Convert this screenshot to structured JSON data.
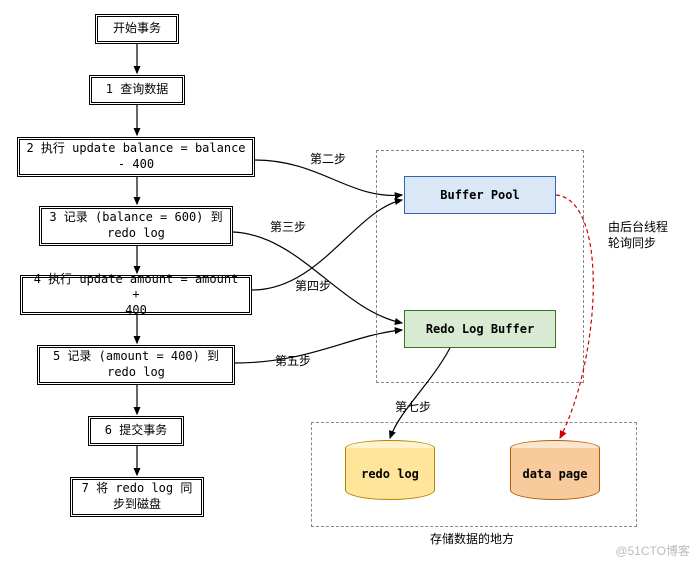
{
  "chart_data": {
    "type": "flowchart",
    "title": "",
    "nodes": [
      {
        "id": "start",
        "label": "开始事务",
        "type": "process"
      },
      {
        "id": "n1",
        "label": "1 查询数据",
        "type": "process"
      },
      {
        "id": "n2",
        "label": "2 执行 update balance = balance - 400",
        "type": "process"
      },
      {
        "id": "n3",
        "label": "3 记录 (balance = 600) 到 redo log",
        "type": "process"
      },
      {
        "id": "n4",
        "label": "4 执行 update amount = amount + 400",
        "type": "process"
      },
      {
        "id": "n5",
        "label": "5 记录 (amount = 400)  到 redo log",
        "type": "process"
      },
      {
        "id": "n6",
        "label": "6 提交事务",
        "type": "process"
      },
      {
        "id": "n7",
        "label": "7 将 redo log 同步到磁盘",
        "type": "process"
      },
      {
        "id": "bp",
        "label": "Buffer Pool",
        "type": "buffer"
      },
      {
        "id": "rlb",
        "label": "Redo Log Buffer",
        "type": "buffer"
      },
      {
        "id": "rlog",
        "label": "redo log",
        "type": "storage"
      },
      {
        "id": "dpage",
        "label": "data page",
        "type": "storage"
      }
    ],
    "edges": [
      {
        "from": "start",
        "to": "n1"
      },
      {
        "from": "n1",
        "to": "n2"
      },
      {
        "from": "n2",
        "to": "n3"
      },
      {
        "from": "n3",
        "to": "n4"
      },
      {
        "from": "n4",
        "to": "n5"
      },
      {
        "from": "n5",
        "to": "n6"
      },
      {
        "from": "n6",
        "to": "n7"
      },
      {
        "from": "n2",
        "to": "bp",
        "label": "第二步"
      },
      {
        "from": "n3",
        "to": "rlb",
        "label": "第三步"
      },
      {
        "from": "n4",
        "to": "bp",
        "label": "第四步"
      },
      {
        "from": "n5",
        "to": "rlb",
        "label": "第五步"
      },
      {
        "from": "rlb",
        "to": "rlog",
        "label": "第七步"
      },
      {
        "from": "bp",
        "to": "dpage",
        "label": "由后台线程轮询同步",
        "style": "dashed"
      }
    ],
    "groups": [
      {
        "label": "",
        "members": [
          "bp",
          "rlb"
        ]
      },
      {
        "label": "存储数据的地方",
        "members": [
          "rlog",
          "dpage"
        ]
      }
    ]
  },
  "flow": {
    "start": "开始事务",
    "n1": "1 查询数据",
    "n2": "2 执行 update balance = balance\n- 400",
    "n3": "3 记录 (balance = 600) 到\nredo log",
    "n4": "4 执行 update amount = amount +\n400",
    "n5": "5 记录 (amount = 400)  到\nredo log",
    "n6": "6 提交事务",
    "n7": "7 将 redo log 同\n步到磁盘"
  },
  "buffers": {
    "buffer_pool": "Buffer Pool",
    "redo_log_buffer": "Redo Log Buffer"
  },
  "edge_labels": {
    "step2": "第二步",
    "step3": "第三步",
    "step4": "第四步",
    "step5": "第五步",
    "step7": "第七步",
    "bg_sync_l1": "由后台线程",
    "bg_sync_l2": "轮询同步"
  },
  "storage": {
    "redo_log": "redo log",
    "data_page": "data page",
    "group_label": "存储数据的地方"
  },
  "watermark": "@51CTO博客"
}
